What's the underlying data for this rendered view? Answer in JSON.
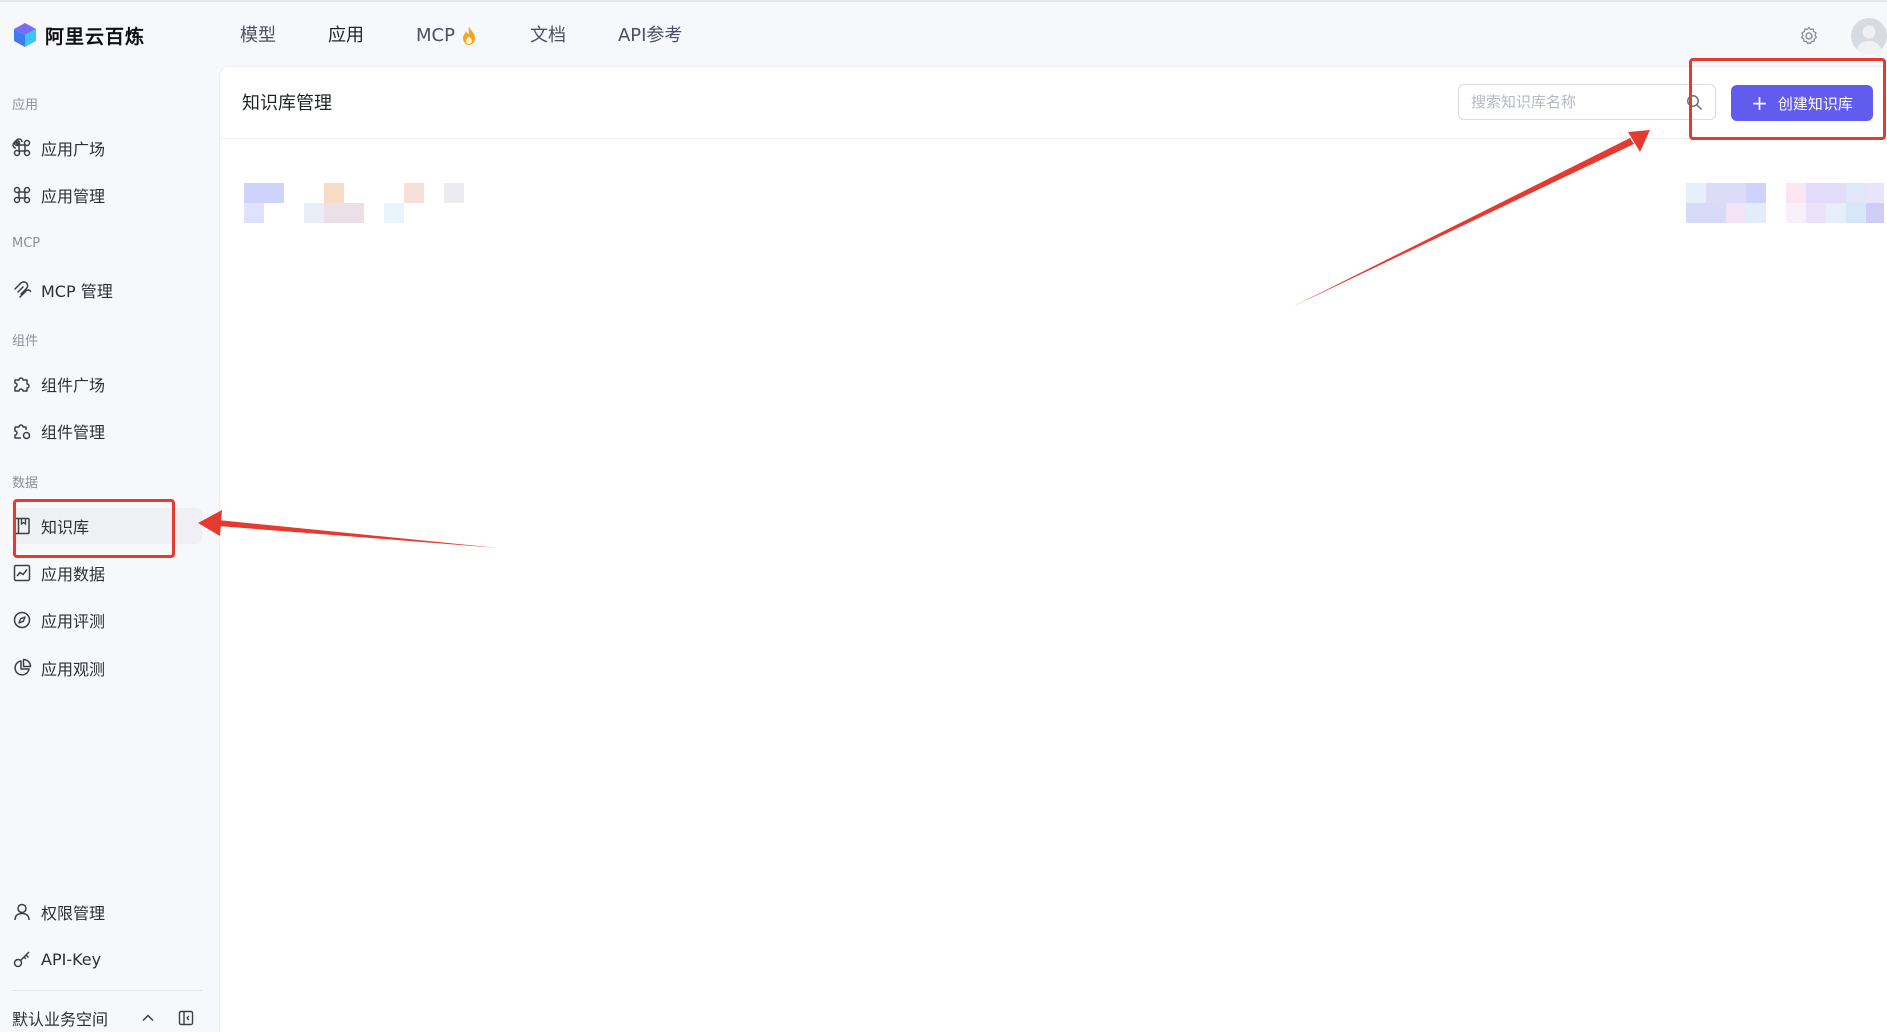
{
  "app": {
    "logo_text": "阿里云百炼"
  },
  "topnav": {
    "items": [
      {
        "label": "模型"
      },
      {
        "label": "应用"
      },
      {
        "label": "MCP"
      },
      {
        "label": "文档"
      },
      {
        "label": "API参考"
      }
    ]
  },
  "sidebar": {
    "sections": [
      {
        "title": "应用"
      },
      {
        "title": "MCP"
      },
      {
        "title": "组件"
      },
      {
        "title": "数据"
      }
    ],
    "items": [
      {
        "label": "应用广场",
        "icon": "command-icon"
      },
      {
        "label": "应用管理",
        "icon": "command-icon"
      },
      {
        "label": "MCP 管理",
        "icon": "mcp-icon"
      },
      {
        "label": "组件广场",
        "icon": "puzzle-icon"
      },
      {
        "label": "组件管理",
        "icon": "puzzle-gear-icon"
      },
      {
        "label": "知识库",
        "icon": "book-icon"
      },
      {
        "label": "应用数据",
        "icon": "chart-icon"
      },
      {
        "label": "应用评测",
        "icon": "compass-icon"
      },
      {
        "label": "应用观测",
        "icon": "pie-icon"
      },
      {
        "label": "权限管理",
        "icon": "user-icon"
      },
      {
        "label": "API-Key",
        "icon": "key-icon"
      }
    ],
    "workspace": "默认业务空间"
  },
  "main": {
    "title": "知识库管理",
    "search_placeholder": "搜索知识库名称",
    "create_button": "创建知识库"
  },
  "colors": {
    "accent": "#615ced",
    "annotation": "#e53a2f",
    "background": "#f7f8fb"
  }
}
